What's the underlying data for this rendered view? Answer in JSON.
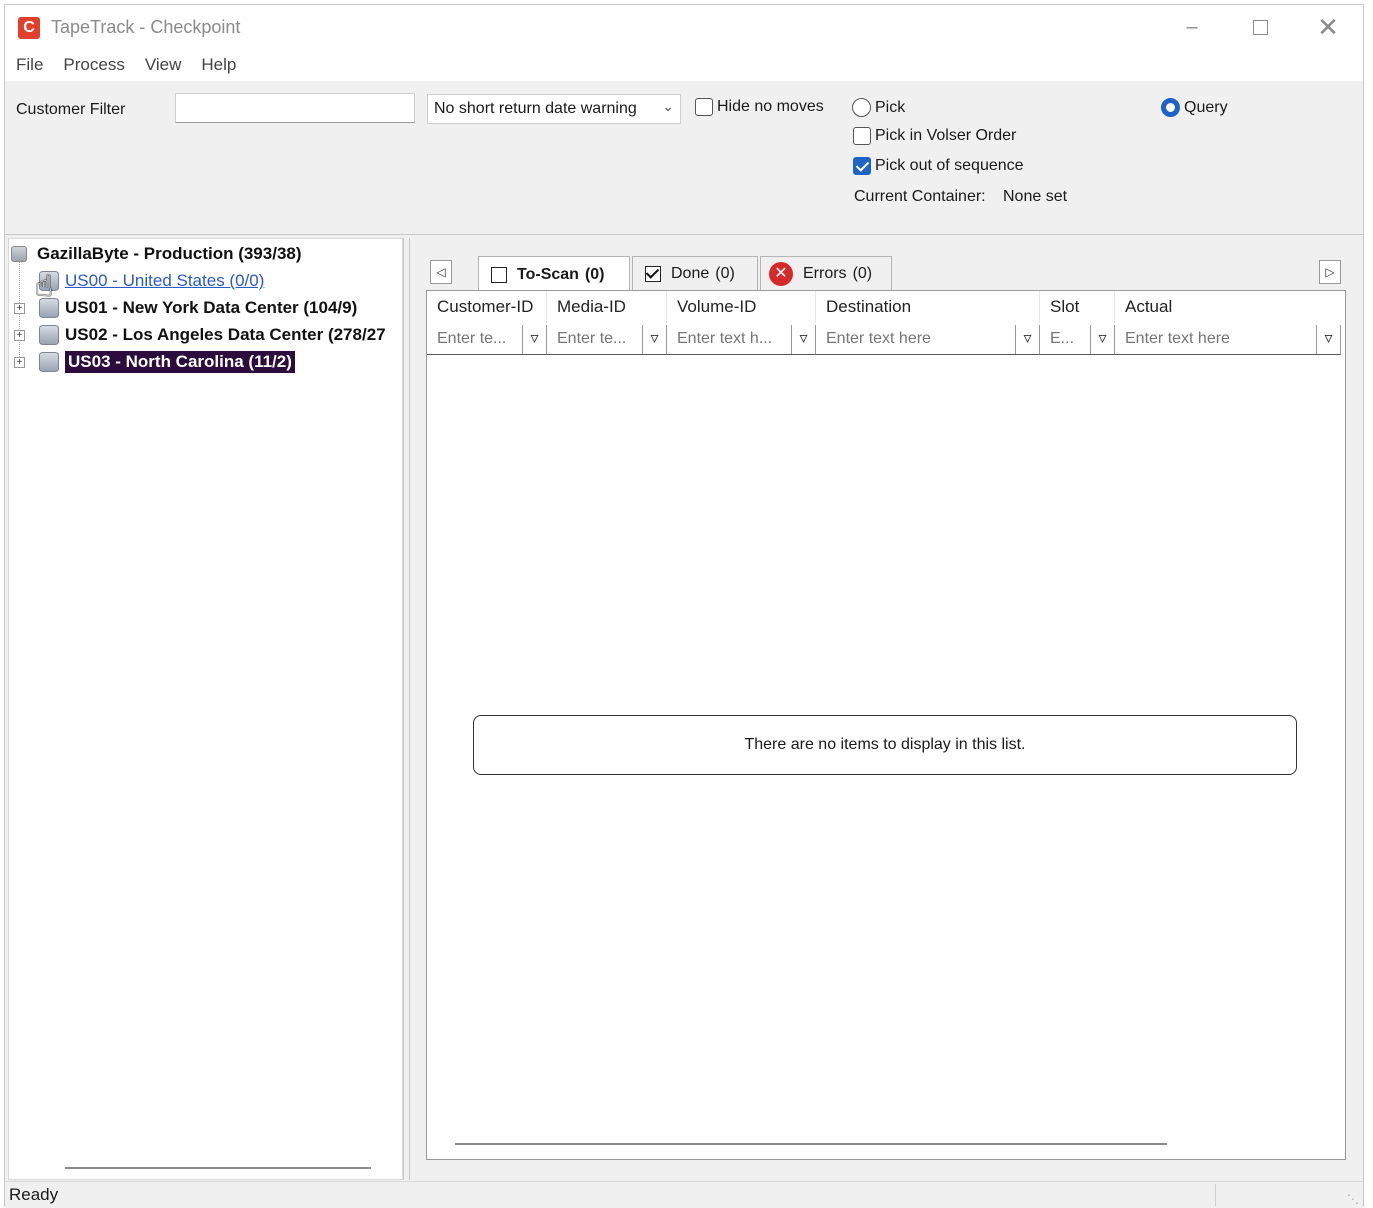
{
  "window": {
    "title": "TapeTrack - Checkpoint",
    "icon_letter": "C",
    "minimize": "–",
    "close": "✕"
  },
  "menu": [
    "File",
    "Process",
    "View",
    "Help"
  ],
  "toolbar": {
    "customer_filter_label": "Customer Filter",
    "customer_filter_value": "",
    "warning_select": "No short return date warning",
    "hide_no_moves": {
      "label": "Hide no moves",
      "checked": false
    },
    "pick": {
      "label": "Pick",
      "selected": false
    },
    "pick_volser_order": {
      "label": "Pick in Volser Order",
      "checked": false
    },
    "pick_out_of_sequence": {
      "label": "Pick out of sequence",
      "checked": true
    },
    "query": {
      "label": "Query",
      "selected": true
    },
    "current_container_label": "Current Container:",
    "current_container_value": "None set"
  },
  "tree": {
    "root": "GazillaByte - Production (393/38)",
    "children": [
      {
        "label": "US00 - United States (0/0)",
        "style": "link"
      },
      {
        "label": "US01 - New York Data Center (104/9)",
        "style": "bold"
      },
      {
        "label": "US02 - Los Angeles Data Center (278/27",
        "style": "bold"
      },
      {
        "label": "US03 - North Carolina (11/2)",
        "style": "selected"
      }
    ]
  },
  "tabs": [
    {
      "label": "To-Scan",
      "count": "(0)",
      "active": true,
      "icon": "checkbox-empty-icon"
    },
    {
      "label": "Done",
      "count": "(0)",
      "active": false,
      "icon": "checkbox-checked-icon"
    },
    {
      "label": "Errors",
      "count": "(0)",
      "active": false,
      "icon": "error-icon"
    }
  ],
  "grid": {
    "columns": [
      {
        "header": "Customer-ID",
        "placeholder": "Enter te..."
      },
      {
        "header": "Media-ID",
        "placeholder": "Enter te..."
      },
      {
        "header": "Volume-ID",
        "placeholder": "Enter text h..."
      },
      {
        "header": "Destination",
        "placeholder": "Enter text here"
      },
      {
        "header": "Slot",
        "placeholder": "E..."
      },
      {
        "header": "Actual",
        "placeholder": "Enter text here"
      }
    ],
    "empty_message": "There are no items to display in this list."
  },
  "status": {
    "text": "Ready"
  }
}
